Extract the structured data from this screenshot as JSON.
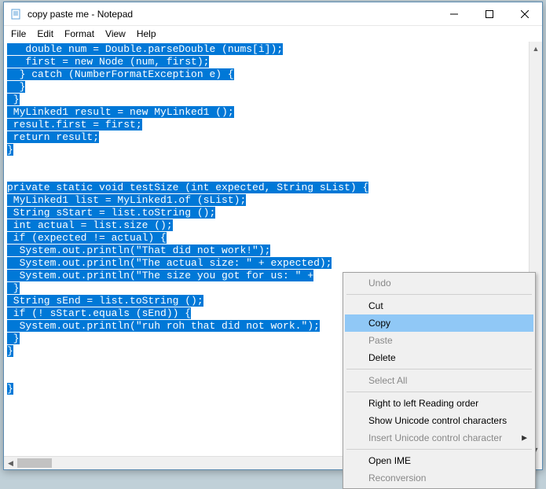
{
  "window": {
    "title": "copy paste me - Notepad"
  },
  "menubar": {
    "file": "File",
    "edit": "Edit",
    "format": "Format",
    "view": "View",
    "help": "Help"
  },
  "code_lines": [
    "   double num = Double.parseDouble (nums[i]);",
    "   first = new Node (num, first);",
    "  } catch (NumberFormatException e) {",
    "  }",
    " }",
    " MyLinked1 result = new MyLinked1 ();",
    " result.first = first;",
    " return result;",
    "}",
    "",
    "",
    "private static void testSize (int expected, String sList) {",
    " MyLinked1 list = MyLinked1.of (sList);",
    " String sStart = list.toString ();",
    " int actual = list.size ();",
    " if (expected != actual) {",
    "  System.out.println(\"That did not work!\");",
    "  System.out.println(\"The actual size: \" + expected);",
    "  System.out.println(\"The size you got for us: \" +",
    " }",
    " String sEnd = list.toString ();",
    " if (! sStart.equals (sEnd)) {",
    "  System.out.println(\"ruh roh that did not work.\");",
    " }",
    "}",
    "",
    "",
    "}"
  ],
  "context_menu": {
    "undo": "Undo",
    "cut": "Cut",
    "copy": "Copy",
    "paste": "Paste",
    "delete": "Delete",
    "select_all": "Select All",
    "rtl": "Right to left Reading order",
    "show_unicode": "Show Unicode control characters",
    "insert_unicode": "Insert Unicode control character",
    "open_ime": "Open IME",
    "reconversion": "Reconversion"
  }
}
